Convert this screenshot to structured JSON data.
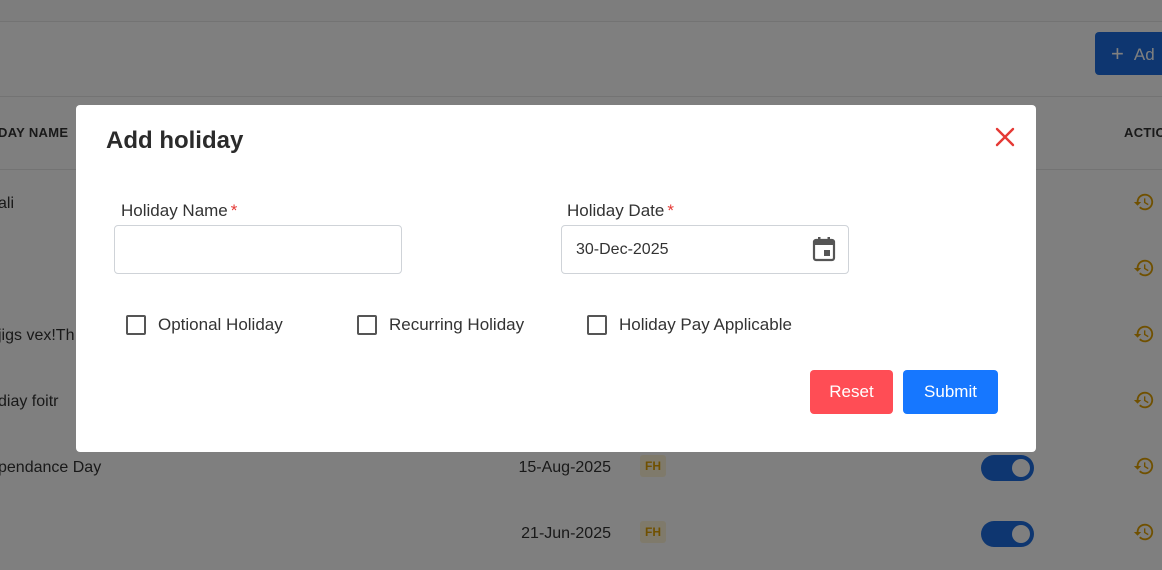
{
  "background": {
    "add_button_label": "Ad",
    "headers": {
      "name": "DAY NAME",
      "action": "ACTIO"
    },
    "rows": [
      {
        "name": "ali",
        "date": "",
        "badge": "",
        "toggle": false
      },
      {
        "name": "",
        "date": "",
        "badge": "",
        "toggle": false
      },
      {
        "name": "jigs vex!Th",
        "date": "",
        "badge": "",
        "toggle": false
      },
      {
        "name": "diay foitr",
        "date": "",
        "badge": "",
        "toggle": false
      },
      {
        "name": "pendance Day",
        "date": "15-Aug-2025",
        "badge": "FH",
        "toggle": true
      },
      {
        "name": "",
        "date": "21-Jun-2025",
        "badge": "FH",
        "toggle": true
      }
    ]
  },
  "modal": {
    "title": "Add holiday",
    "close_icon": "close-icon",
    "holiday_name": {
      "label": "Holiday Name",
      "required_mark": "*",
      "value": ""
    },
    "holiday_date": {
      "label": "Holiday Date",
      "required_mark": "*",
      "value": "30-Dec-2025",
      "icon": "calendar-icon"
    },
    "checkboxes": [
      {
        "label": "Optional Holiday",
        "checked": false
      },
      {
        "label": "Recurring Holiday",
        "checked": false
      },
      {
        "label": "Holiday Pay Applicable",
        "checked": false
      }
    ],
    "reset_label": "Reset",
    "submit_label": "Submit"
  },
  "colors": {
    "primary": "#1677ff",
    "danger": "#ff4d55",
    "close": "#e53935",
    "badge_text": "#e0a100",
    "history_icon": "#e0a100"
  }
}
